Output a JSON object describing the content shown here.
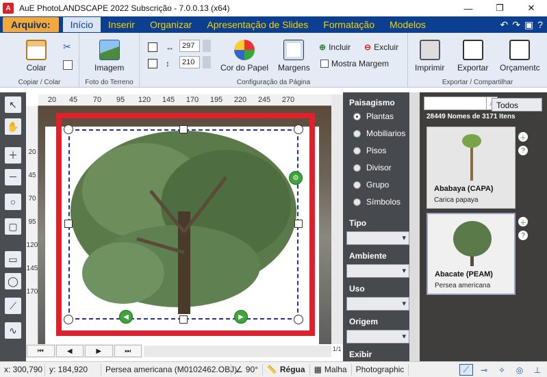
{
  "window": {
    "title": "AuE PhotoLANDSCAPE 2022 Subscrição - 7.0.0.13 (x64)",
    "app_icon_label": "A",
    "minimize": "—",
    "maximize": "❐",
    "close": "✕"
  },
  "ribbon_tabs": {
    "file": "Arquivo:",
    "tabs": [
      "Início",
      "Inserir",
      "Organizar",
      "Apresentação de Slides",
      "Formatação",
      "Modelos"
    ],
    "active_index": 0
  },
  "ribbon": {
    "groups": {
      "copy_paste": {
        "label": "Copiar / Colar",
        "paste": "Colar"
      },
      "terrain_photo": {
        "label": "Foto do Terreno",
        "image": "Imagem"
      },
      "page_setup": {
        "label": "Configuração da Página",
        "width_value": "297",
        "height_value": "210",
        "paper_color": "Cor do Papel",
        "margins": "Margens",
        "include": "Incluir",
        "exclude": "Excluir",
        "show_margin": "Mostra Margem"
      },
      "export_share": {
        "label": "Exportar / Compartilhar",
        "print": "Imprimir",
        "export": "Exportar",
        "budget": "Orçamentc"
      }
    }
  },
  "ruler": {
    "top_labels": [
      "20",
      "45",
      "70",
      "95",
      "120",
      "145",
      "170",
      "195",
      "220",
      "245",
      "270"
    ],
    "left_labels": [
      "20",
      "45",
      "70",
      "95",
      "120",
      "145",
      "170"
    ]
  },
  "canvas_nav": {
    "first": "⏮",
    "prev": "◀",
    "next": "▶",
    "last": "⏭",
    "page": "1/1"
  },
  "categories": {
    "landscaping_header": "Paisagismo",
    "options": [
      "Plantas",
      "Mobiliarios",
      "Pisos",
      "Divisor",
      "Grupo",
      "Símbolos"
    ],
    "selected": "Plantas",
    "filters": [
      "Tipo",
      "Ambiente",
      "Uso",
      "Origem",
      "Exibir"
    ]
  },
  "library": {
    "search_placeholder": "",
    "filter_value": "Todos",
    "count_text": "28449 Nomes de 3171 Itens",
    "items": [
      {
        "title": "Ababaya (CAPA)",
        "subtitle": "Carica papaya"
      },
      {
        "title": "Abacate (PEAM)",
        "subtitle": "Persea americana"
      }
    ]
  },
  "status": {
    "x": "x: 300,790",
    "y": "y: 184,920",
    "object": "Persea americana (M0102462.OBJ)",
    "angle": "90°",
    "ruler": "Régua",
    "grid": "Malha",
    "mode": "Photographic"
  },
  "colors": {
    "ribbon_blue": "#0c3f8f",
    "tab_yellow": "#f4d400",
    "file_orange": "#f2a83b",
    "selection_red": "#e0202a",
    "dash_blue": "#1a2fbf",
    "handle_green": "#3ea53a"
  }
}
